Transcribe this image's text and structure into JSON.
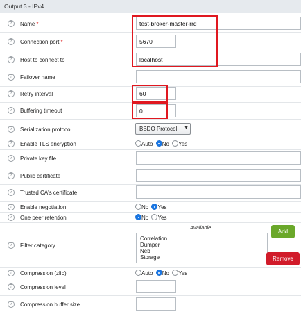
{
  "header": {
    "title": "Output 3 - IPv4"
  },
  "help_glyph": "?",
  "required_mark": "*",
  "fields": {
    "name": {
      "label": "Name",
      "value": "test-broker-master-rrd"
    },
    "connection_port": {
      "label": "Connection port",
      "value": "5670"
    },
    "host": {
      "label": "Host to connect to",
      "value": "localhost"
    },
    "failover": {
      "label": "Failover name",
      "value": ""
    },
    "retry_interval": {
      "label": "Retry interval",
      "value": "60"
    },
    "buffering_timeout": {
      "label": "Buffering timeout",
      "value": "0"
    },
    "serialization": {
      "label": "Serialization protocol",
      "value": "BBDO Protocol"
    },
    "tls": {
      "label": "Enable TLS encryption",
      "options": [
        "Auto",
        "No",
        "Yes"
      ],
      "selected": "No"
    },
    "private_key": {
      "label": "Private key file.",
      "value": ""
    },
    "public_cert": {
      "label": "Public certificate",
      "value": ""
    },
    "trusted_ca": {
      "label": "Trusted CA's certificate",
      "value": ""
    },
    "negotiation": {
      "label": "Enable negotiation",
      "options": [
        "No",
        "Yes"
      ],
      "selected": "Yes"
    },
    "one_peer": {
      "label": "One peer retention",
      "options": [
        "No",
        "Yes"
      ],
      "selected": "No"
    },
    "filter_category": {
      "label": "Filter category",
      "available_label": "Available",
      "items": [
        "Correlation",
        "Dumper",
        "Neb",
        "Storage"
      ],
      "add_label": "Add",
      "remove_label": "Remove"
    },
    "compression": {
      "label": "Compression (zlib)",
      "options": [
        "Auto",
        "No",
        "Yes"
      ],
      "selected": "No"
    },
    "compression_level": {
      "label": "Compression level",
      "value": ""
    },
    "compression_buffer": {
      "label": "Compression buffer size",
      "value": ""
    }
  },
  "colors": {
    "highlight": "#e01820",
    "add": "#6aa82a",
    "remove": "#d11b2a",
    "radio_on": "#1a78e6"
  }
}
